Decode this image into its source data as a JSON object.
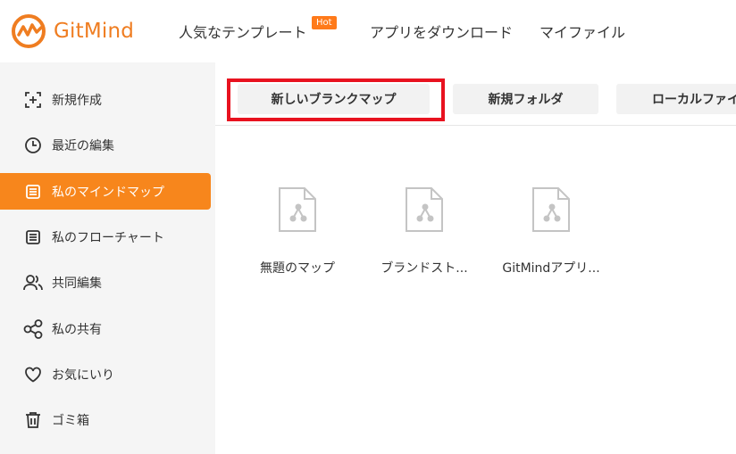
{
  "app": {
    "brand": "GitMind",
    "brand_color": "#ef7d21"
  },
  "nav": {
    "templates": "人気なテンプレート",
    "hot_badge": "Hot",
    "download": "アプリをダウンロード",
    "my_files": "マイファイル"
  },
  "sidebar": {
    "items": [
      {
        "label": "新規作成",
        "icon": "add-square-icon"
      },
      {
        "label": "最近の編集",
        "icon": "clock-icon"
      },
      {
        "label": "私のマインドマップ",
        "icon": "document-list-icon",
        "active": true
      },
      {
        "label": "私のフローチャート",
        "icon": "document-list-icon"
      },
      {
        "label": "共同編集",
        "icon": "users-icon"
      },
      {
        "label": "私の共有",
        "icon": "share-icon"
      },
      {
        "label": "お気にいり",
        "icon": "heart-icon"
      },
      {
        "label": "ゴミ箱",
        "icon": "trash-icon"
      }
    ]
  },
  "toolbar": {
    "new_blank_map": "新しいブランクマップ",
    "new_folder": "新規フォルダ",
    "local_file": "ローカルファイ"
  },
  "files": [
    {
      "name": "無題のマップ"
    },
    {
      "name": "ブランドスト..."
    },
    {
      "name": "GitMindアプリ..."
    }
  ],
  "colors": {
    "active": "#f7861c",
    "highlight": "#e8121f"
  }
}
